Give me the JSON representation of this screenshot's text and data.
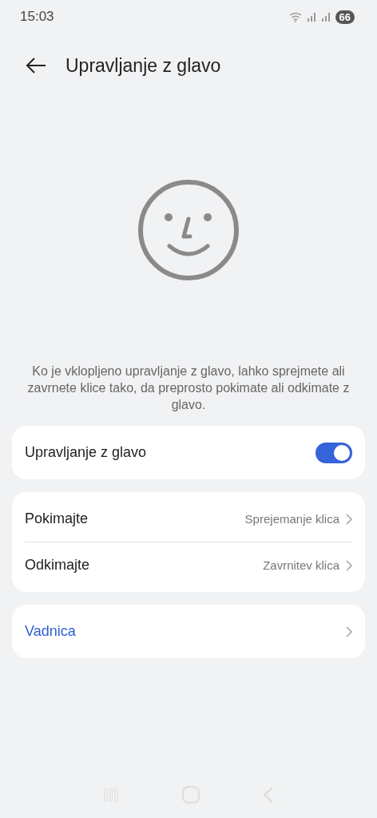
{
  "status_bar": {
    "time": "15:03",
    "battery": "66"
  },
  "header": {
    "title": "Upravljanje z glavo"
  },
  "description": "Ko je vklopljeno upravljanje z glavo, lahko sprejmete ali zavrnete klice tako, da preprosto pokimate ali odkimate z glavo.",
  "toggle_card": {
    "label": "Upravljanje z glavo",
    "on": true
  },
  "gestures": [
    {
      "label": "Pokimajte",
      "value": "Sprejemanje klica"
    },
    {
      "label": "Odkimajte",
      "value": "Zavrnitev klica"
    }
  ],
  "tutorial": {
    "label": "Vadnica"
  }
}
